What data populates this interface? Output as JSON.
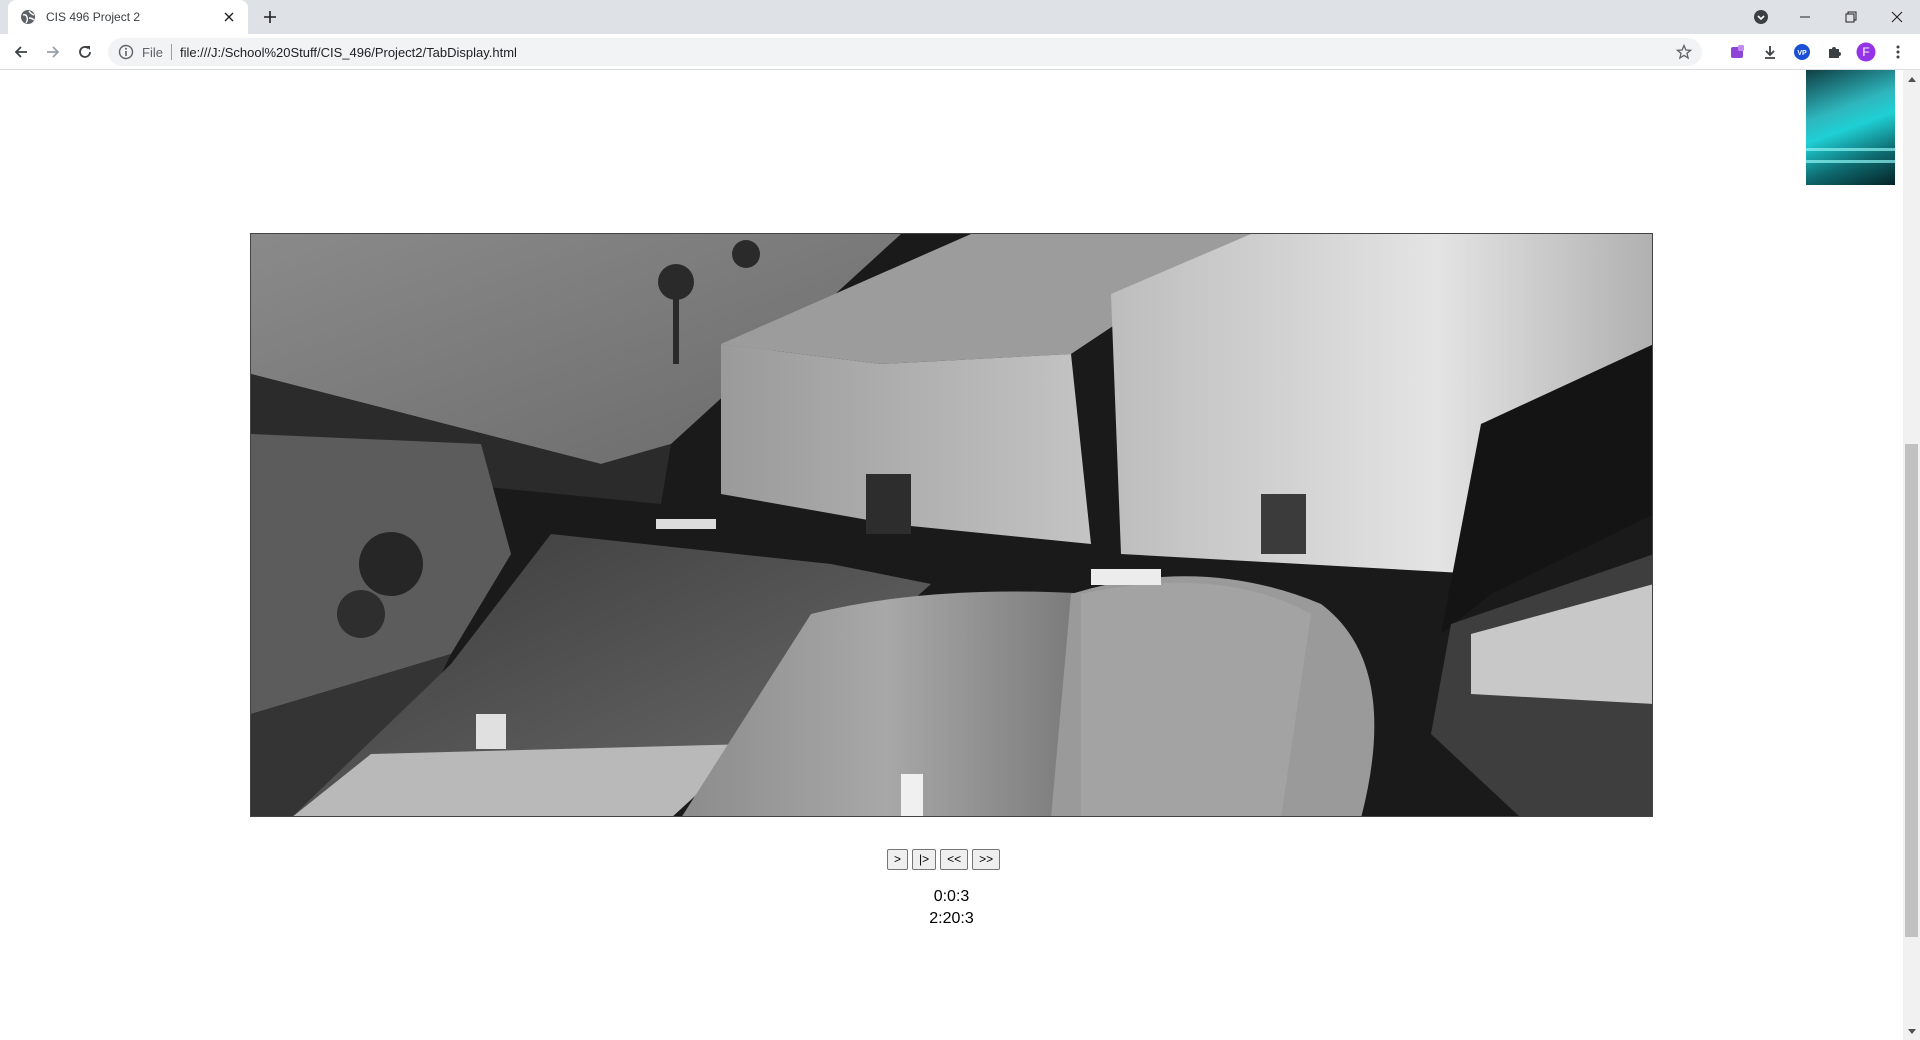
{
  "browser": {
    "tab": {
      "title": "CIS 496 Project 2"
    },
    "omnibox": {
      "scheme_label": "File",
      "url": "file:///J:/School%20Stuff/CIS_496/Project2/TabDisplay.html"
    },
    "profile_initial": "F",
    "icons": {
      "favicon": "globe-icon",
      "back": "back-arrow-icon",
      "forward": "forward-arrow-icon",
      "reload": "reload-icon",
      "info": "info-icon",
      "bookmark": "star-icon",
      "extensions": [
        "extension-puzzle-icon",
        "download-icon",
        "vpn-icon",
        "extensions-icon"
      ],
      "menu": "kebab-menu-icon"
    },
    "colors": {
      "tabstrip": "#dee1e6",
      "profile": "#9334e6",
      "vpn": "#1a4fd6"
    }
  },
  "page": {
    "controls": {
      "play_label": ">",
      "step_label": "|>",
      "rewind_label": "<<",
      "forward_label": ">>"
    },
    "current_time": "0:0:3",
    "duration": "2:20:3"
  }
}
